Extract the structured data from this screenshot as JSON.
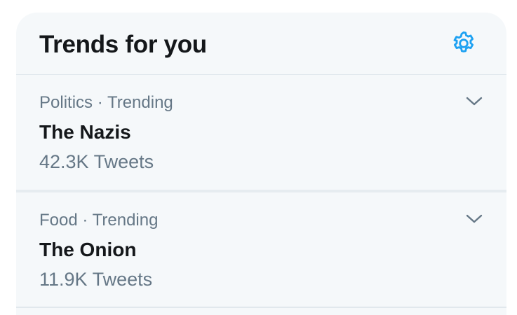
{
  "panel": {
    "title": "Trends for you"
  },
  "trends": [
    {
      "category": "Politics",
      "separator": "·",
      "status": "Trending",
      "name": "The Nazis",
      "tweet_count": "42.3K Tweets"
    },
    {
      "category": "Food",
      "separator": "·",
      "status": "Trending",
      "name": "The Onion",
      "tweet_count": "11.9K Tweets"
    }
  ],
  "icons": {
    "settings": "gear-icon",
    "more": "chevron-down-icon"
  },
  "colors": {
    "accent": "#1da1f2",
    "background": "#f5f8fa",
    "primary_text": "#14171a",
    "secondary_text": "#657786",
    "divider": "#e1e8ed"
  }
}
